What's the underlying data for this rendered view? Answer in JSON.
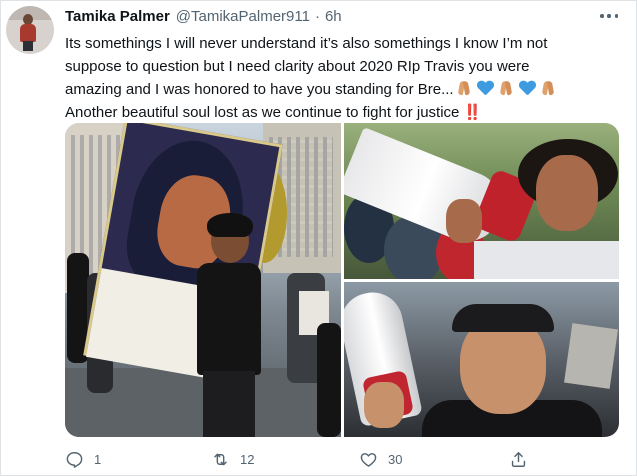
{
  "author": {
    "display_name": "Tamika Palmer",
    "handle": "@TamikaPalmer911",
    "separator": "·",
    "time": "6h"
  },
  "tweet": {
    "line1": "Its somethings I will never understand it’s also somethings I know I’m not",
    "line2": "suppose to question but I need clarity about 2020 RIp Travis you were",
    "line3_text": "amazing and I was honored to have you standing for Bre...",
    "line4_text": "Another beautiful soul lost as we continue to fight for justice",
    "line4_emoji": "‼️",
    "line3_emoji": [
      "folded-hands",
      "blue-heart",
      "folded-hands",
      "blue-heart",
      "folded-hands"
    ]
  },
  "media": {
    "photos": [
      "protest-portrait-photo",
      "megaphone-man-photo",
      "bandana-man-photo"
    ]
  },
  "actions": {
    "reply_count": "1",
    "retweet_count": "12",
    "like_count": "30",
    "share_label": ""
  },
  "colors": {
    "text_primary": "#0f1419",
    "text_secondary": "#536471",
    "emoji_heart": "#3e9be0",
    "emoji_bang": "#d3142a"
  },
  "icons": {
    "more": "more-horizontal-icon",
    "reply": "reply-bubble-icon",
    "retweet": "retweet-icon",
    "like": "heart-outline-icon",
    "share": "share-upload-icon"
  }
}
